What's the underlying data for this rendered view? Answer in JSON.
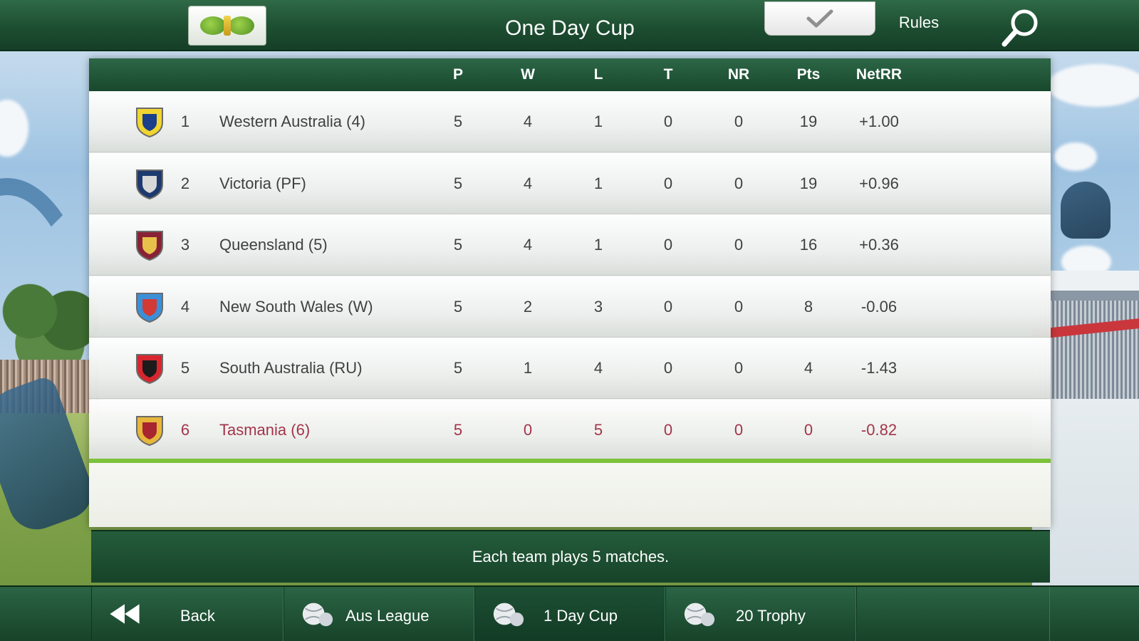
{
  "header": {
    "title": "One Day Cup",
    "rules_label": "Rules"
  },
  "table": {
    "columns": {
      "p": "P",
      "w": "W",
      "l": "L",
      "t": "T",
      "nr": "NR",
      "pts": "Pts",
      "netrr": "NetRR"
    },
    "rows": [
      {
        "pos": "1",
        "team": "Western Australia (4)",
        "p": "5",
        "w": "4",
        "l": "1",
        "t": "0",
        "nr": "0",
        "pts": "19",
        "netrr": "+1.00",
        "crest_colors": [
          "#f1d530",
          "#1b3f8a"
        ]
      },
      {
        "pos": "2",
        "team": "Victoria (PF)",
        "p": "5",
        "w": "4",
        "l": "1",
        "t": "0",
        "nr": "0",
        "pts": "19",
        "netrr": "+0.96",
        "crest_colors": [
          "#1d3a6e",
          "#d8d8d8"
        ]
      },
      {
        "pos": "3",
        "team": "Queensland (5)",
        "p": "5",
        "w": "4",
        "l": "1",
        "t": "0",
        "nr": "0",
        "pts": "16",
        "netrr": "+0.36",
        "crest_colors": [
          "#8a2236",
          "#e7c14a"
        ]
      },
      {
        "pos": "4",
        "team": "New South Wales (W)",
        "p": "5",
        "w": "2",
        "l": "3",
        "t": "0",
        "nr": "0",
        "pts": "8",
        "netrr": "-0.06",
        "crest_colors": [
          "#3b8fd8",
          "#d23a36"
        ]
      },
      {
        "pos": "5",
        "team": "South Australia (RU)",
        "p": "5",
        "w": "1",
        "l": "4",
        "t": "0",
        "nr": "0",
        "pts": "4",
        "netrr": "-1.43",
        "crest_colors": [
          "#d8262e",
          "#1b1b1b"
        ]
      },
      {
        "pos": "6",
        "team": "Tasmania (6)",
        "p": "5",
        "w": "0",
        "l": "5",
        "t": "0",
        "nr": "0",
        "pts": "0",
        "netrr": "-0.82",
        "crest_colors": [
          "#e6b73a",
          "#a8262f"
        ]
      }
    ],
    "highlight_color": "#a3344a"
  },
  "info": {
    "text": "Each team plays 5 matches."
  },
  "bottom_nav": {
    "back_label": "Back",
    "tabs": [
      {
        "label": "Aus League",
        "icon": "cricket-balls-icon"
      },
      {
        "label": "1 Day Cup",
        "icon": "cricket-balls-icon"
      },
      {
        "label": "20 Trophy",
        "icon": "cricket-balls-icon"
      }
    ],
    "active_tab": "1 Day Cup"
  },
  "colors": {
    "bar_green": "#1d4e31",
    "accent_line": "#7cc23a"
  }
}
